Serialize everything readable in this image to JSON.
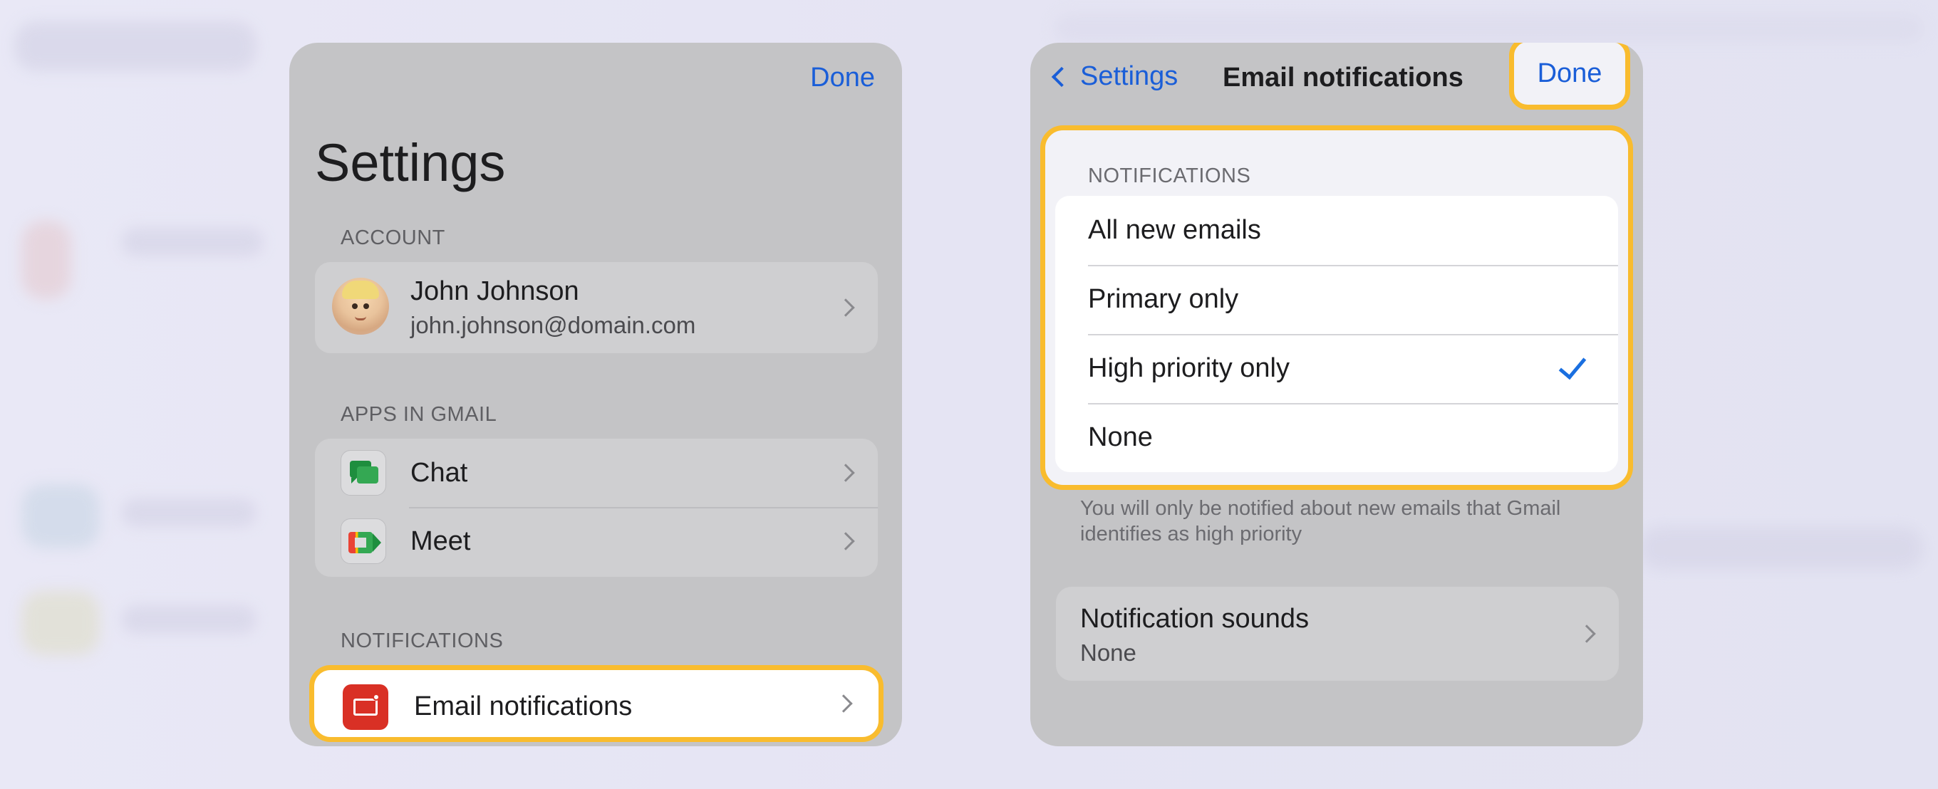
{
  "left_panel": {
    "done_label": "Done",
    "title": "Settings",
    "account": {
      "section_label": "ACCOUNT",
      "name": "John Johnson",
      "email": "john.johnson@domain.com"
    },
    "apps": {
      "section_label": "APPS IN GMAIL",
      "items": [
        {
          "label": "Chat",
          "icon": "chat-icon"
        },
        {
          "label": "Meet",
          "icon": "meet-icon"
        }
      ]
    },
    "notifications": {
      "section_label": "NOTIFICATIONS",
      "email_notifications_label": "Email notifications",
      "icon": "email-notification-icon"
    }
  },
  "right_panel": {
    "back_label": "Settings",
    "title": "Email notifications",
    "done_label": "Done",
    "section_label": "NOTIFICATIONS",
    "options": [
      {
        "label": "All new emails",
        "selected": false
      },
      {
        "label": "Primary only",
        "selected": false
      },
      {
        "label": "High priority only",
        "selected": true
      },
      {
        "label": "None",
        "selected": false
      }
    ],
    "footnote": "You will only be notified about new emails that Gmail identifies as high priority",
    "sounds": {
      "title": "Notification sounds",
      "value": "None"
    }
  },
  "colors": {
    "accent": "#1a5ed8",
    "highlight": "#f9bc2e",
    "check": "#1a6fe0"
  }
}
